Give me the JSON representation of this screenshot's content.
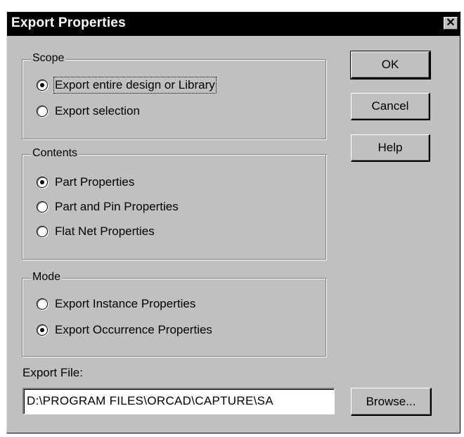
{
  "window": {
    "title": "Export Properties",
    "close_glyph": "✕"
  },
  "scope": {
    "legend": "Scope",
    "options": [
      {
        "label": "Export entire design or Library",
        "checked": true
      },
      {
        "label": "Export selection",
        "checked": false
      }
    ]
  },
  "contents": {
    "legend": "Contents",
    "options": [
      {
        "label": "Part Properties",
        "checked": true
      },
      {
        "label": "Part and Pin Properties",
        "checked": false
      },
      {
        "label": "Flat Net Properties",
        "checked": false
      }
    ]
  },
  "mode": {
    "legend": "Mode",
    "options": [
      {
        "label": "Export Instance Properties",
        "checked": false
      },
      {
        "label": "Export Occurrence Properties",
        "checked": true
      }
    ]
  },
  "buttons": {
    "ok": "OK",
    "cancel": "Cancel",
    "help": "Help",
    "browse": "Browse..."
  },
  "export_file": {
    "label": "Export File:",
    "value": "D:\\PROGRAM FILES\\ORCAD\\CAPTURE\\SA"
  }
}
